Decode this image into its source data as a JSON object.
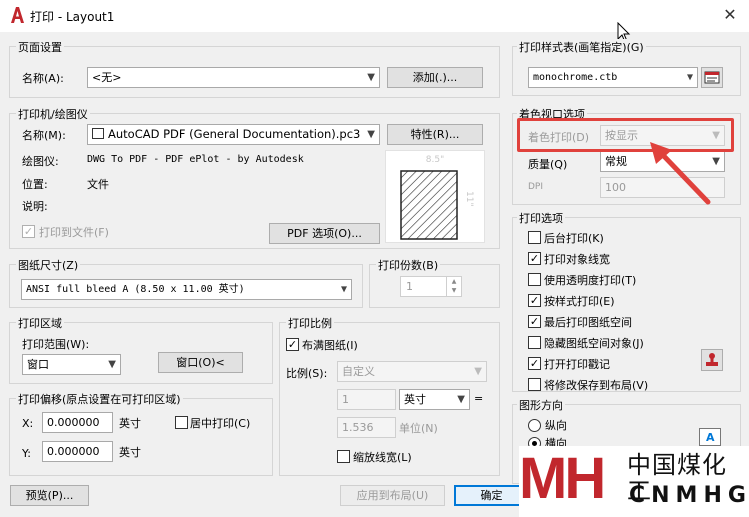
{
  "window": {
    "title": "打印 - Layout1"
  },
  "page_setup": {
    "group_label": "页面设置",
    "name_label": "名称(A):",
    "name_value": "<无>",
    "add_button": "添加(.)..."
  },
  "printer": {
    "group_label": "打印机/绘图仪",
    "name_label": "名称(M):",
    "name_value": "AutoCAD PDF (General Documentation).pc3",
    "properties_button": "特性(R)...",
    "plotter_label": "绘图仪:",
    "plotter_value": "DWG To PDF - PDF ePlot - by Autodesk",
    "location_label": "位置:",
    "location_value": "文件",
    "description_label": "说明:",
    "print_to_file": "打印到文件(F)",
    "pdf_options_button": "PDF 选项(O)...",
    "preview_width": "8.5\"",
    "preview_height": "11\""
  },
  "paper_size": {
    "group_label": "图纸尺寸(Z)",
    "value": "ANSI full bleed A (8.50 x 11.00 英寸)"
  },
  "copies": {
    "group_label": "打印份数(B)",
    "value": "1"
  },
  "plot_area": {
    "group_label": "打印区域",
    "range_label": "打印范围(W):",
    "range_value": "窗口",
    "window_button": "窗口(O)<"
  },
  "plot_offset": {
    "group_label": "打印偏移(原点设置在可打印区域)",
    "x_label": "X:",
    "x_value": "0.000000",
    "x_unit": "英寸",
    "y_label": "Y:",
    "y_value": "0.000000",
    "y_unit": "英寸",
    "center_label": "居中打印(C)"
  },
  "plot_scale": {
    "group_label": "打印比例",
    "fit_label": "布满图纸(I)",
    "scale_label": "比例(S):",
    "scale_value": "自定义",
    "num_value": "1",
    "unit_value": "英寸",
    "equals": "=",
    "den_value": "1.536",
    "den_unit": "单位(N)",
    "lineweights_label": "缩放线宽(L)"
  },
  "plot_style_table": {
    "group_label": "打印样式表(画笔指定)(G)",
    "value": "monochrome.ctb"
  },
  "shaded_viewport": {
    "group_label": "着色视口选项",
    "shade_label": "着色打印(D)",
    "shade_value": "按显示",
    "quality_label": "质量(Q)",
    "quality_value": "常规",
    "dpi_label": "DPI",
    "dpi_value": "100"
  },
  "plot_options": {
    "group_label": "打印选项",
    "items": [
      {
        "label": "后台打印(K)",
        "checked": false
      },
      {
        "label": "打印对象线宽",
        "checked": true
      },
      {
        "label": "使用透明度打印(T)",
        "checked": false
      },
      {
        "label": "按样式打印(E)",
        "checked": true
      },
      {
        "label": "最后打印图纸空间",
        "checked": true
      },
      {
        "label": "隐藏图纸空间对象(J)",
        "checked": false
      },
      {
        "label": "打开打印戳记",
        "checked": true
      },
      {
        "label": "将修改保存到布局(V)",
        "checked": false
      }
    ]
  },
  "orientation": {
    "group_label": "图形方向",
    "portrait": "纵向",
    "landscape": "横向",
    "selected": "landscape"
  },
  "footer": {
    "preview_button": "预览(P)...",
    "apply_button": "应用到布局(U)",
    "ok_button": "确定"
  },
  "watermark": {
    "logo_text": "MH",
    "cn_text": "中国煤化工",
    "en_text": "CNMHG"
  },
  "colors": {
    "highlight": "#e0413c",
    "accent": "#0078d7",
    "title_icon": "#c1272d"
  }
}
